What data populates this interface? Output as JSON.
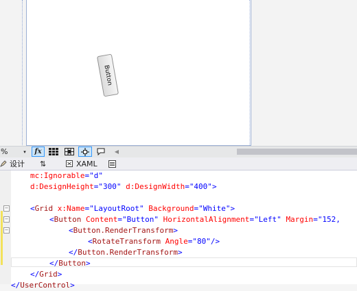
{
  "designer": {
    "rotated_button_label": "Button"
  },
  "toolbar": {
    "zoom_value": "%",
    "zoom_arrow": "▾",
    "fx_label": "fx",
    "grid_icon": "grid-icon",
    "snap_icon": "snap-to-grid-icon",
    "snaplines_icon": "snaplines-icon",
    "annotation_icon": "annotation-icon",
    "scroll_left": "◀",
    "accent": "#3399ff"
  },
  "tabs": {
    "design_label": "设计",
    "swap_label": "⇅",
    "xaml_label": "XAML",
    "split_icon": "split-pane-icon"
  },
  "code": {
    "l1a": "mc:Ignorable",
    "l1b": "=",
    "l1c": "\"d\"",
    "l2a": "d:DesignHeight",
    "l2b": "=",
    "l2c": "\"300\"",
    "l2d": "d:DesignWidth",
    "l2e": "=",
    "l2f": "\"400\"",
    "l2g": ">",
    "l4a": "<",
    "l4b": "Grid",
    "l4c": "x:Name",
    "l4d": "=",
    "l4e": "\"LayoutRoot\"",
    "l4f": "Background",
    "l4g": "=",
    "l4h": "\"White\"",
    "l4i": ">",
    "l5a": "<",
    "l5b": "Button",
    "l5c": "Content",
    "l5d": "=",
    "l5e": "\"Button\"",
    "l5f": "HorizontalAlignment",
    "l5g": "=",
    "l5h": "\"Left\"",
    "l5i": "Margin",
    "l5j": "=",
    "l5k": "\"152,",
    "l6a": "<",
    "l6b": "Button.RenderTransform",
    "l6c": ">",
    "l7a": "<",
    "l7b": "RotateTransform",
    "l7c": "Angle",
    "l7d": "=",
    "l7e": "\"80\"",
    "l7f": "/>",
    "l8a": "</",
    "l8b": "Button.RenderTransform",
    "l8c": ">",
    "l9a": "</",
    "l9b": "Button",
    "l9c": ">",
    "l10a": "</",
    "l10b": "Grid",
    "l10c": ">",
    "l11a": "</",
    "l11b": "UserControl",
    "l11c": ">",
    "collapse_glyph": "−"
  }
}
